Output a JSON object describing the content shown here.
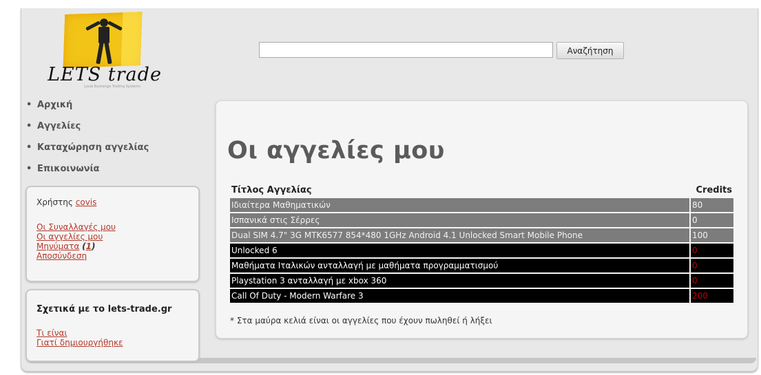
{
  "logo": {
    "wordmark": "LETS trade",
    "tagline": "Local Exchange Trading Systems"
  },
  "search": {
    "placeholder": "",
    "value": "",
    "button_label": "Αναζήτηση"
  },
  "nav": {
    "bullet": "•",
    "items": [
      "Αρχική",
      "Αγγελίες",
      "Καταχώρηση αγγελίας",
      "Επικοινωνία"
    ]
  },
  "user_box": {
    "user_prefix": "Χρήστης",
    "username": "covis",
    "links": [
      "Οι Συναλλαγές μου",
      "Οι αγγελίες μου"
    ],
    "messages_label": "Μηνύματα",
    "messages_count": "1",
    "logout": "Αποσύνδεση"
  },
  "about_box": {
    "title": "Σχετικά με το lets-trade.gr",
    "links": [
      "Τι είναι",
      "Γιατί δημιουργήθηκε"
    ]
  },
  "main": {
    "title": "Οι αγγελίες μου",
    "columns": {
      "title": "Τίτλος Αγγελίας",
      "credits": "Credits"
    },
    "rows": [
      {
        "title": "Ιδιαίτερα Μαθηματικών",
        "credits": "80",
        "status": "active"
      },
      {
        "title": "Ισπανικά στις Σέρρες",
        "credits": "0",
        "status": "active"
      },
      {
        "title": "Dual SIM 4.7\" 3G MTK6577 854*480 1GHz Android 4.1 Unlocked Smart Mobile Phone",
        "credits": "100",
        "status": "active"
      },
      {
        "title": "Unlocked 6",
        "credits": "0",
        "status": "sold_or_expired"
      },
      {
        "title": "Μαθήματα Ιταλικών ανταλλαγή με μαθήματα προγραμματισμού",
        "credits": "0",
        "status": "sold_or_expired"
      },
      {
        "title": "Playstation 3 ανταλλαγή με xbox 360",
        "credits": "0",
        "status": "sold_or_expired"
      },
      {
        "title": "Call Of Duty - Modern Warfare 3",
        "credits": "200",
        "status": "sold_or_expired"
      }
    ],
    "footnote": "* Στα μαύρα κελιά είναι οι αγγελίες που έχουν πωληθεί ή λήξει"
  },
  "colors": {
    "active_row": "#7c7c7c",
    "inactive_row": "#000000",
    "inactive_credits": "#c00000",
    "link": "#b33a2c"
  }
}
